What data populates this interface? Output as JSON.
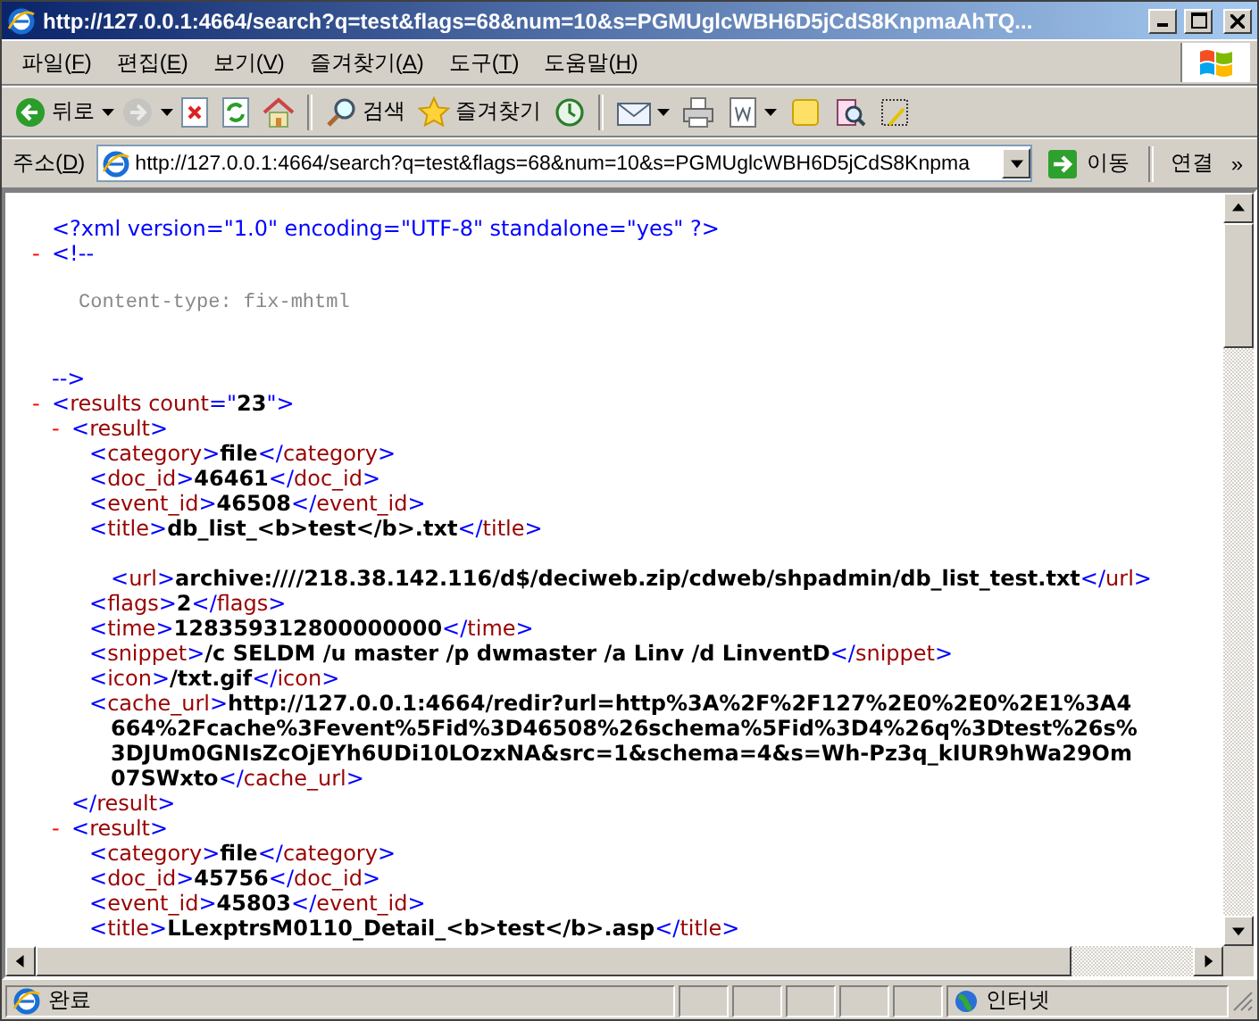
{
  "window": {
    "title": "http://127.0.0.1:4664/search?q=test&flags=68&num=10&s=PGMUglcWBH6D5jCdS8KnpmaAhTQ..."
  },
  "menu": [
    {
      "before": "파일(",
      "key": "F",
      "after": ")"
    },
    {
      "before": "편집(",
      "key": "E",
      "after": ")"
    },
    {
      "before": "보기(",
      "key": "V",
      "after": ")"
    },
    {
      "before": "즐겨찾기(",
      "key": "A",
      "after": ")"
    },
    {
      "before": "도구(",
      "key": "T",
      "after": ")"
    },
    {
      "before": "도움말(",
      "key": "H",
      "after": ")"
    }
  ],
  "toolbar": {
    "back": {
      "label": "뒤로",
      "disabled": false
    },
    "forward": {
      "disabled": true
    },
    "search": {
      "label": "검색"
    },
    "favorites": {
      "label": "즐겨찾기"
    }
  },
  "address_bar": {
    "label": {
      "before": "주소(",
      "key": "D",
      "after": ")"
    },
    "url": "http://127.0.0.1:4664/search?q=test&flags=68&num=10&s=PGMUglcWBH6D5jCdS8Knpma",
    "go": "이동",
    "links": "연결",
    "more": "»"
  },
  "document": {
    "declaration": "<?xml version=\"1.0\" encoding=\"UTF-8\" standalone=\"yes\" ?>",
    "comment": {
      "toggle": "-",
      "open": "<!--",
      "text": "Content-type: fix-mhtml",
      "close": "-->"
    },
    "root": {
      "toggle": "-",
      "open": [
        {
          "kind": "punct",
          "text": "<"
        },
        {
          "kind": "name",
          "text": "results"
        },
        {
          "kind": "attr",
          "text": " count"
        },
        {
          "kind": "punct",
          "text": "=\""
        },
        {
          "kind": "value",
          "text": "23"
        },
        {
          "kind": "punct",
          "text": "\">"
        }
      ],
      "children": [
        {
          "toggle": "-",
          "open": [
            {
              "kind": "punct",
              "text": "<"
            },
            {
              "kind": "name",
              "text": "result"
            },
            {
              "kind": "punct",
              "text": ">"
            }
          ],
          "close": [
            {
              "kind": "punct",
              "text": "</"
            },
            {
              "kind": "name",
              "text": "result"
            },
            {
              "kind": "punct",
              "text": ">"
            }
          ],
          "children": [
            {
              "kind": "leaf",
              "tokens": [
                {
                  "kind": "punct",
                  "text": "<"
                },
                {
                  "kind": "name",
                  "text": "category"
                },
                {
                  "kind": "punct",
                  "text": ">"
                },
                {
                  "kind": "value",
                  "text": "file"
                },
                {
                  "kind": "punct",
                  "text": "</"
                },
                {
                  "kind": "name",
                  "text": "category"
                },
                {
                  "kind": "punct",
                  "text": ">"
                }
              ]
            },
            {
              "kind": "leaf",
              "tokens": [
                {
                  "kind": "punct",
                  "text": "<"
                },
                {
                  "kind": "name",
                  "text": "doc_id"
                },
                {
                  "kind": "punct",
                  "text": ">"
                },
                {
                  "kind": "value",
                  "text": "46461"
                },
                {
                  "kind": "punct",
                  "text": "</"
                },
                {
                  "kind": "name",
                  "text": "doc_id"
                },
                {
                  "kind": "punct",
                  "text": ">"
                }
              ]
            },
            {
              "kind": "leaf",
              "tokens": [
                {
                  "kind": "punct",
                  "text": "<"
                },
                {
                  "kind": "name",
                  "text": "event_id"
                },
                {
                  "kind": "punct",
                  "text": ">"
                },
                {
                  "kind": "value",
                  "text": "46508"
                },
                {
                  "kind": "punct",
                  "text": "</"
                },
                {
                  "kind": "name",
                  "text": "event_id"
                },
                {
                  "kind": "punct",
                  "text": ">"
                }
              ]
            },
            {
              "kind": "leaf",
              "tokens": [
                {
                  "kind": "punct",
                  "text": "<"
                },
                {
                  "kind": "name",
                  "text": "title"
                },
                {
                  "kind": "punct",
                  "text": ">"
                },
                {
                  "kind": "value",
                  "text": "db_list_<b>test</b>.txt"
                },
                {
                  "kind": "punct",
                  "text": "</"
                },
                {
                  "kind": "name",
                  "text": "title"
                },
                {
                  "kind": "punct",
                  "text": ">"
                }
              ]
            },
            {
              "kind": "spaced",
              "tokens": [
                {
                  "kind": "punct",
                  "text": "<"
                },
                {
                  "kind": "name",
                  "text": "url"
                },
                {
                  "kind": "punct",
                  "text": ">"
                },
                {
                  "kind": "value",
                  "text": "archive:////218.38.142.116/d$/deciweb.zip/cdweb/shpadmin/db_list_test.txt"
                },
                {
                  "kind": "punct",
                  "text": "</"
                },
                {
                  "kind": "name",
                  "text": "url"
                },
                {
                  "kind": "punct",
                  "text": ">"
                }
              ]
            },
            {
              "kind": "leaf",
              "tokens": [
                {
                  "kind": "punct",
                  "text": "<"
                },
                {
                  "kind": "name",
                  "text": "flags"
                },
                {
                  "kind": "punct",
                  "text": ">"
                },
                {
                  "kind": "value",
                  "text": "2"
                },
                {
                  "kind": "punct",
                  "text": "</"
                },
                {
                  "kind": "name",
                  "text": "flags"
                },
                {
                  "kind": "punct",
                  "text": ">"
                }
              ]
            },
            {
              "kind": "leaf",
              "tokens": [
                {
                  "kind": "punct",
                  "text": "<"
                },
                {
                  "kind": "name",
                  "text": "time"
                },
                {
                  "kind": "punct",
                  "text": ">"
                },
                {
                  "kind": "value",
                  "text": "128359312800000000"
                },
                {
                  "kind": "punct",
                  "text": "</"
                },
                {
                  "kind": "name",
                  "text": "time"
                },
                {
                  "kind": "punct",
                  "text": ">"
                }
              ]
            },
            {
              "kind": "leaf",
              "tokens": [
                {
                  "kind": "punct",
                  "text": "<"
                },
                {
                  "kind": "name",
                  "text": "snippet"
                },
                {
                  "kind": "punct",
                  "text": ">"
                },
                {
                  "kind": "value",
                  "text": "/c SELDM /u master /p dwmaster /a Linv /d LinventD"
                },
                {
                  "kind": "punct",
                  "text": "</"
                },
                {
                  "kind": "name",
                  "text": "snippet"
                },
                {
                  "kind": "punct",
                  "text": ">"
                }
              ]
            },
            {
              "kind": "leaf",
              "tokens": [
                {
                  "kind": "punct",
                  "text": "<"
                },
                {
                  "kind": "name",
                  "text": "icon"
                },
                {
                  "kind": "punct",
                  "text": ">"
                },
                {
                  "kind": "value",
                  "text": "/txt.gif"
                },
                {
                  "kind": "punct",
                  "text": "</"
                },
                {
                  "kind": "name",
                  "text": "icon"
                },
                {
                  "kind": "punct",
                  "text": ">"
                }
              ]
            },
            {
              "kind": "leaf",
              "tokens": [
                {
                  "kind": "punct",
                  "text": "<"
                },
                {
                  "kind": "name",
                  "text": "cache_url"
                },
                {
                  "kind": "punct",
                  "text": ">"
                },
                {
                  "kind": "value",
                  "text": "http://127.0.0.1:4664/redir?url=http%3A%2F%2F127%2E0%2E0%2E1%3A4664%2Fcache%3Fevent%5Fid%3D46508%26schema%5Fid%3D4%26q%3Dtest%26s%3DJUm0GNIsZcOjEYh6UDi10LOzxNA&src=1&schema=4&s=Wh-Pz3q_kIUR9hWa29Om07SWxto"
                },
                {
                  "kind": "punct",
                  "text": "</"
                },
                {
                  "kind": "name",
                  "text": "cache_url"
                },
                {
                  "kind": "punct",
                  "text": ">"
                }
              ]
            }
          ]
        },
        {
          "toggle": "-",
          "open": [
            {
              "kind": "punct",
              "text": "<"
            },
            {
              "kind": "name",
              "text": "result"
            },
            {
              "kind": "punct",
              "text": ">"
            }
          ],
          "children": [
            {
              "kind": "leaf",
              "tokens": [
                {
                  "kind": "punct",
                  "text": "<"
                },
                {
                  "kind": "name",
                  "text": "category"
                },
                {
                  "kind": "punct",
                  "text": ">"
                },
                {
                  "kind": "value",
                  "text": "file"
                },
                {
                  "kind": "punct",
                  "text": "</"
                },
                {
                  "kind": "name",
                  "text": "category"
                },
                {
                  "kind": "punct",
                  "text": ">"
                }
              ]
            },
            {
              "kind": "leaf",
              "tokens": [
                {
                  "kind": "punct",
                  "text": "<"
                },
                {
                  "kind": "name",
                  "text": "doc_id"
                },
                {
                  "kind": "punct",
                  "text": ">"
                },
                {
                  "kind": "value",
                  "text": "45756"
                },
                {
                  "kind": "punct",
                  "text": "</"
                },
                {
                  "kind": "name",
                  "text": "doc_id"
                },
                {
                  "kind": "punct",
                  "text": ">"
                }
              ]
            },
            {
              "kind": "leaf",
              "tokens": [
                {
                  "kind": "punct",
                  "text": "<"
                },
                {
                  "kind": "name",
                  "text": "event_id"
                },
                {
                  "kind": "punct",
                  "text": ">"
                },
                {
                  "kind": "value",
                  "text": "45803"
                },
                {
                  "kind": "punct",
                  "text": "</"
                },
                {
                  "kind": "name",
                  "text": "event_id"
                },
                {
                  "kind": "punct",
                  "text": ">"
                }
              ]
            },
            {
              "kind": "leaf",
              "tokens": [
                {
                  "kind": "punct",
                  "text": "<"
                },
                {
                  "kind": "name",
                  "text": "title"
                },
                {
                  "kind": "punct",
                  "text": ">"
                },
                {
                  "kind": "value",
                  "text": "LLexptrsM0110_Detail_<b>test</b>.asp"
                },
                {
                  "kind": "punct",
                  "text": "</"
                },
                {
                  "kind": "name",
                  "text": "title"
                },
                {
                  "kind": "punct",
                  "text": ">"
                }
              ]
            }
          ]
        }
      ]
    }
  },
  "status_bar": {
    "text": "완료",
    "zone": "인터넷"
  }
}
